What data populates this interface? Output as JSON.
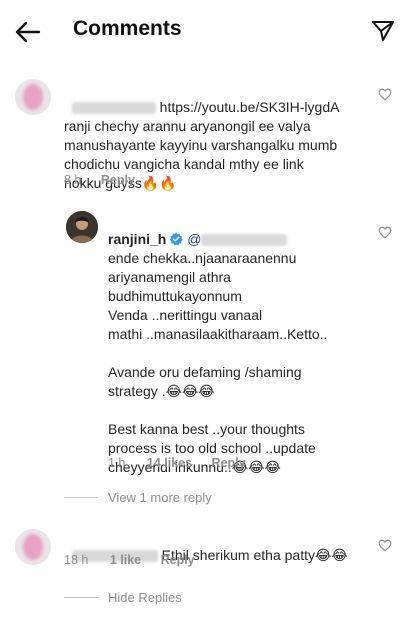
{
  "header": {
    "title": "Comments"
  },
  "comments": [
    {
      "lines": [
        "https://youtu.be/SK3IH-lygdA",
        "ranji chechy arannu aryanongil ee valya",
        "manushayante kayyinu varshangalku mumb",
        "chodichu vangicha kandal mthy ee link",
        "nokku guyss🔥🔥"
      ],
      "time": "8 h",
      "reply_label": "Reply"
    }
  ],
  "reply": {
    "username": "ranjini_h",
    "mention_prefix": "@",
    "lines": [
      "ende chekka..njaanaraanennu",
      "ariyanamengil athra",
      "budhimuttukayonnum",
      "Venda ..nerittingu vanaal",
      "mathi ..manasilaakitharaam..Ketto..",
      "",
      "Avande oru defaming /shaming",
      "strategy .😂😂😂",
      "",
      "Best kanna best ..your thoughts",
      "process is too old school ..update",
      "cheyyendi irikunnu..😂😂😂"
    ],
    "time": "1 h",
    "likes": "14 likes",
    "reply_label": "Reply"
  },
  "view_more": "View 1 more reply",
  "comment2": {
    "text": "Ethil sherikum etha patty😂😂",
    "time": "18 h",
    "likes": "1 like",
    "reply_label": "Reply"
  },
  "hide_replies": "Hide Replies",
  "colors": {
    "verified": "#3897f0",
    "muted": "#8e8e8e",
    "text": "#262626"
  }
}
